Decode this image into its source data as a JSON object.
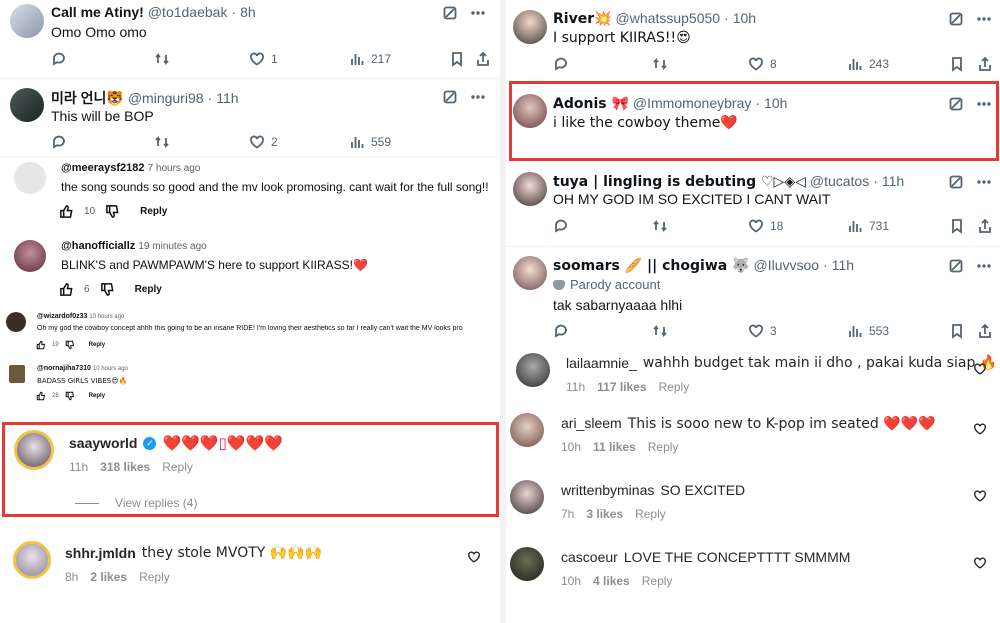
{
  "left": {
    "tweets": [
      {
        "name": "Call me Atiny!",
        "handle": "@to1daebak",
        "time": "8h",
        "text": "Omo Omo omo",
        "likes": "1",
        "views": "217"
      },
      {
        "name": "미라 언니🐯",
        "handle": "@minguri98",
        "time": "11h",
        "text": "This will be BOP",
        "likes": "2",
        "views": "559"
      }
    ],
    "yt_comments": [
      {
        "handle": "@meeraysf2182",
        "time": "7 hours ago",
        "text": "the song sounds so good and the mv look promosing. cant wait for the full song!!",
        "likes": "10",
        "reply": "Reply"
      },
      {
        "handle": "@hanofficiallz",
        "time": "19 minutes ago",
        "text": "BLINK'S and PAWMPAWM'S here to support KIIRASS!❤️",
        "likes": "6",
        "reply": "Reply"
      },
      {
        "handle": "@wizardof0z33",
        "time": "10 hours ago",
        "text": "Oh my god the cowboy concept ahhh this going to be an insane RIDE! I'm loving their aesthetics so far I really can't wait the MV looks pro",
        "likes": "19",
        "reply": "Reply"
      },
      {
        "handle": "@nornajiha7310",
        "time": "10 hours ago",
        "text": "BADASS GIRLS VIBES😍🔥",
        "likes": "28",
        "reply": "Reply"
      }
    ],
    "ig_comments": [
      {
        "name": "saayworld",
        "text": "❤️❤️❤️▯❤️❤️❤️",
        "time": "11h",
        "likes": "318 likes",
        "reply": "Reply",
        "view_replies": "View replies (4)"
      },
      {
        "name": "shhr.jmldn",
        "text": "they stole MVOTY 🙌🙌🙌",
        "time": "8h",
        "likes": "2 likes",
        "reply": "Reply"
      }
    ]
  },
  "right": {
    "tweets": [
      {
        "name": "River💥",
        "handle": "@whatssup5050",
        "time": "10h",
        "text": "I support KIIRAS!!😍",
        "likes": "8",
        "views": "243"
      },
      {
        "name": "Adonis 🎀",
        "handle": "@Immomoneybray",
        "time": "10h",
        "text": "i like the cowboy theme❤️"
      },
      {
        "name": "tuya | lingling is debuting ♡▷◈◁",
        "handle": "@tucatos",
        "time": "11h",
        "text": "OH MY GOD IM SO EXCITED I CANT WAIT",
        "likes": "18",
        "views": "731"
      },
      {
        "name": "soomars 🥖 || chogiwa 🐺",
        "handle": "@Iluvvsoo",
        "time": "11h",
        "badge": "Parody account",
        "text": "tak sabarnyaaaa hlhi",
        "likes": "3",
        "views": "553"
      }
    ],
    "ig_comments": [
      {
        "name": "lailaamnie_",
        "text": "wahhh budget tak main ii dho , pakai kuda siap 🔥",
        "time": "11h",
        "likes": "117 likes",
        "reply": "Reply"
      },
      {
        "name": "ari_sleem",
        "text": "This is sooo new to K-pop im seated ❤️❤️❤️",
        "time": "10h",
        "likes": "11 likes",
        "reply": "Reply"
      },
      {
        "name": "writtenbyminas",
        "text": "SO EXCITED",
        "time": "7h",
        "likes": "3 likes",
        "reply": "Reply"
      },
      {
        "name": "cascoeur",
        "text": "LOVE THE CONCEPTTTT SMMMM",
        "time": "10h",
        "likes": "4 likes",
        "reply": "Reply"
      }
    ]
  },
  "colors": {
    "highlight": "#e53935",
    "heart": "#e0245e",
    "muted": "#536471"
  }
}
